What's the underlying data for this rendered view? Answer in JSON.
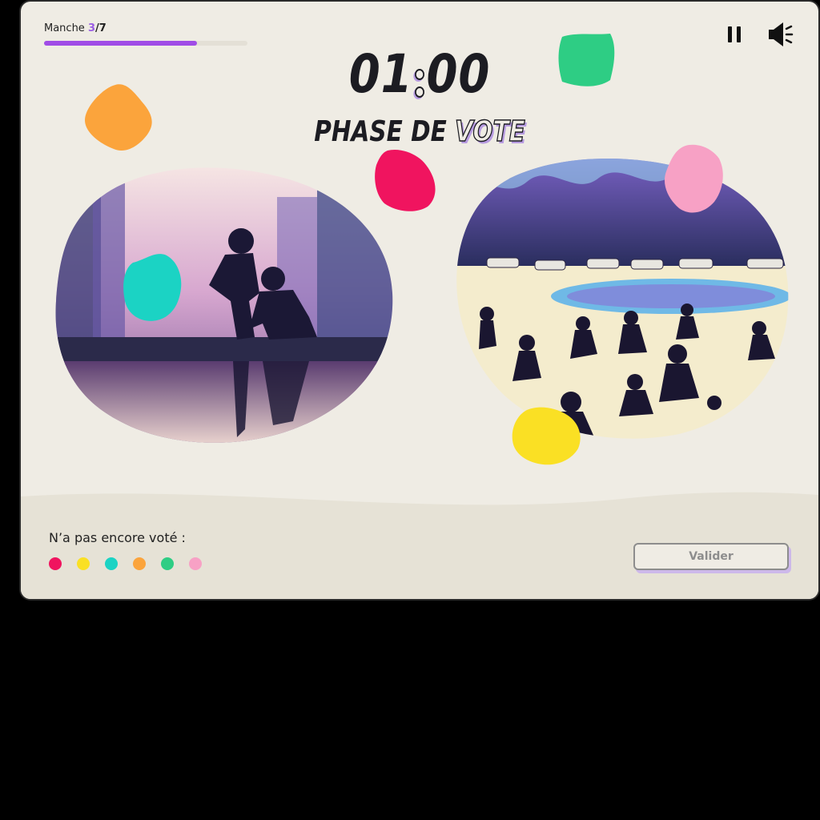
{
  "header": {
    "round_label": "Manche",
    "round_current": "3",
    "round_total": "/7",
    "round_progress": 0.75
  },
  "timer": {
    "minutes": "01",
    "seconds": "00"
  },
  "phase": {
    "prefix": "PHASE DE",
    "highlight": "VOTE"
  },
  "controls": {
    "pause_icon": "pause-icon",
    "sound_icon": "speaker-icon"
  },
  "images": [
    {
      "subject": "two children silhouettes playing by a puddle at sunset"
    },
    {
      "subject": "crowd of silhouettes running in a park with parked cars"
    }
  ],
  "voting": {
    "not_voted_label": "N’a pas encore voté :",
    "players": [
      "#f0145f",
      "#fae024",
      "#1bd3c4",
      "#fba43c",
      "#2ecd84",
      "#f7a1c5"
    ]
  },
  "validate_label": "Valider",
  "colors": {
    "background": "#efece4",
    "accent": "#a04ce6",
    "orange": "#fba43c",
    "green": "#2ecd84",
    "pink_red": "#f0145f",
    "pink": "#f7a1c5",
    "cyan": "#1bd3c4",
    "yellow": "#fae024"
  }
}
